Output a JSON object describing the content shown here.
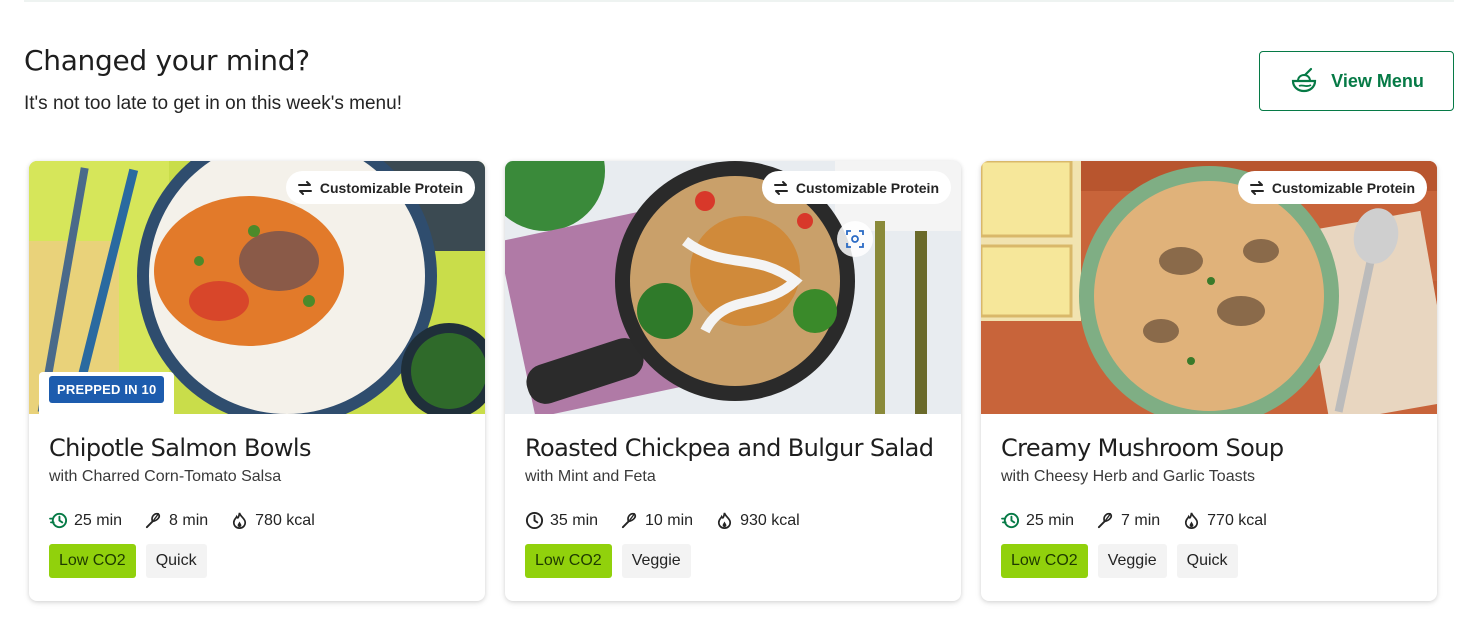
{
  "header": {
    "title": "Changed your mind?",
    "subtitle": "It's not too late to get in on this week's menu!",
    "view_menu_label": "View Menu"
  },
  "colors": {
    "brand_green": "#067a46",
    "tag_green": "#91d10c",
    "prepped_blue": "#1d5cae"
  },
  "cards": [
    {
      "badge": "Customizable Protein",
      "prepped": "PREPPED IN 10",
      "title": "Chipotle Salmon Bowls",
      "subtitle": "with Charred Corn-Tomato Salsa",
      "time": "25 min",
      "time_icon": "quick-clock-icon",
      "prep": "8 min",
      "calories": "780 kcal",
      "tags": [
        "Low CO2",
        "Quick"
      ]
    },
    {
      "badge": "Customizable Protein",
      "title": "Roasted Chickpea and Bulgur Salad",
      "subtitle": "with Mint and Feta",
      "time": "35 min",
      "time_icon": "clock-icon",
      "prep": "10 min",
      "calories": "930 kcal",
      "tags": [
        "Low CO2",
        "Veggie"
      ]
    },
    {
      "badge": "Customizable Protein",
      "title": "Creamy Mushroom Soup",
      "subtitle": "with Cheesy Herb and Garlic Toasts",
      "time": "25 min",
      "time_icon": "quick-clock-icon",
      "prep": "7 min",
      "calories": "770 kcal",
      "tags": [
        "Low CO2",
        "Veggie",
        "Quick"
      ]
    }
  ]
}
